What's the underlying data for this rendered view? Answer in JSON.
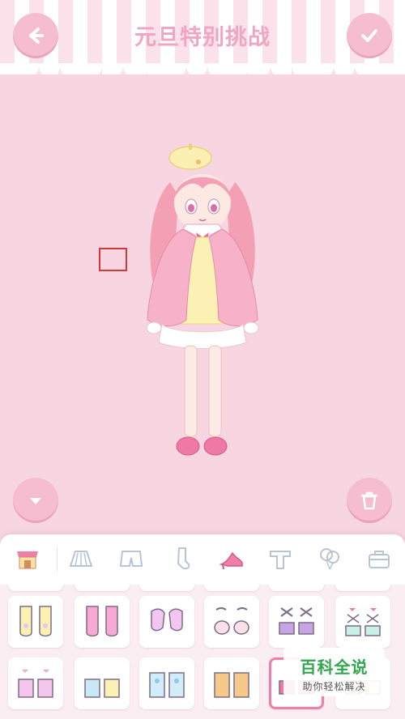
{
  "header": {
    "title": "元旦特别挑战",
    "back_icon": "back-arrow-icon",
    "confirm_icon": "checkmark-icon"
  },
  "stage": {
    "collapse_icon": "chevron-down-icon",
    "delete_icon": "trash-icon"
  },
  "categories": [
    {
      "name": "shop",
      "icon": "shop-icon"
    },
    {
      "name": "skirt",
      "icon": "skirt-icon"
    },
    {
      "name": "shorts",
      "icon": "shorts-icon"
    },
    {
      "name": "socks",
      "icon": "sock-icon"
    },
    {
      "name": "shoes",
      "icon": "high-heel-icon",
      "active": true
    },
    {
      "name": "tops",
      "icon": "tshirt-icon"
    },
    {
      "name": "balloons",
      "icon": "balloon-icon"
    },
    {
      "name": "bags",
      "icon": "bag-icon"
    }
  ],
  "colors": {
    "accent": "#f6bccf",
    "title": "#f0a6c2",
    "background": "#f7d6e2"
  },
  "watermark": {
    "main": "百科全说",
    "sub": "助你轻松解决"
  }
}
